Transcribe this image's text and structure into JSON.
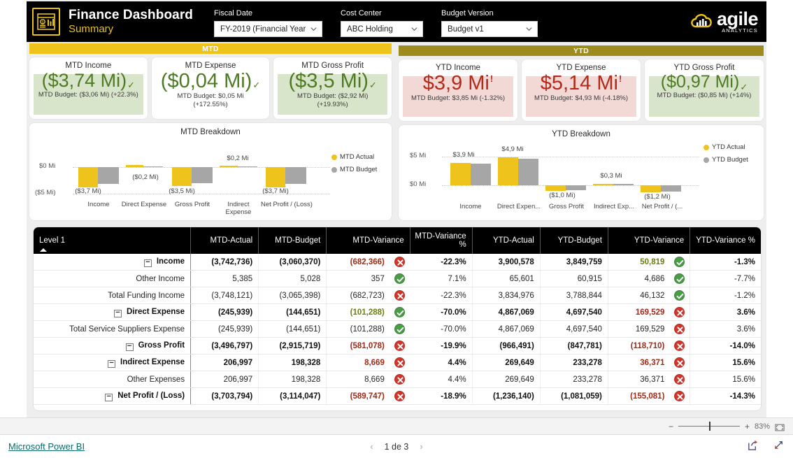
{
  "header": {
    "title": "Finance Dashboard",
    "subtitle": "Summary",
    "logo_icon": "finance-report-icon",
    "brand_name": "agile",
    "brand_tagline": "ANALYTICS",
    "slicers": [
      {
        "label": "Fiscal Date",
        "value": "FY-2019 (Financial Year) ..."
      },
      {
        "label": "Cost Center",
        "value": "ABC Holding"
      },
      {
        "label": "Budget Version",
        "value": "Budget v1"
      }
    ]
  },
  "colors": {
    "mtd_band": "#edc31c",
    "ytd_band": "#9d8b1d",
    "actual": "#edc31c",
    "budget": "#a6a6a6",
    "good": "#4e7a24",
    "bad": "#b5291b",
    "good_bg": "#d9e5ca",
    "bad_bg": "#f3d9d5"
  },
  "mtd_panel": {
    "band": "MTD",
    "cards": [
      {
        "title": "MTD Income",
        "value": "($3,74 Mi)",
        "mark": "✓",
        "state": "good",
        "sub_line1": "MTD Budget: ($3,06 Mi) (+22.3%)",
        "sub_line2": ""
      },
      {
        "title": "MTD Expense",
        "value": "($0,04 Mi)",
        "mark": "✓",
        "state": "good",
        "sub_line1": "MTD Budget: $0,05 Mi",
        "sub_line2": "(+172.55%)"
      },
      {
        "title": "MTD Gross Profit",
        "value": "($3,5 Mi)",
        "mark": "✓",
        "state": "good",
        "sub_line1": "MTD Budget: ($2,92 Mi)",
        "sub_line2": "(+19.93%)"
      }
    ]
  },
  "ytd_panel": {
    "band": "YTD",
    "cards": [
      {
        "title": "YTD Income",
        "value": "$3,9 Mi",
        "mark": "!",
        "state": "bad",
        "sub_line1": "MTD Budget: $3,85 Mi (-1.32%)",
        "sub_line2": ""
      },
      {
        "title": "YTD Expense",
        "value": "$5,14 Mi",
        "mark": "!",
        "state": "bad",
        "sub_line1": "MTD Budget: $4,93 Mi (-4.18%)",
        "sub_line2": ""
      },
      {
        "title": "YTD Gross Profit",
        "value": "($0,97 Mi)",
        "mark": "✓",
        "state": "good",
        "sub_line1": "MTD Budget: ($0,85 Mi) (+14%)",
        "sub_line2": ""
      }
    ]
  },
  "chart_data": [
    {
      "type": "bar",
      "title": "MTD Breakdown",
      "categories": [
        "Income",
        "Direct Expense",
        "Gross Profit",
        "Indirect Expense",
        "Net Profit / (Loss)"
      ],
      "series": [
        {
          "name": "MTD Actual",
          "values": [
            -3.74,
            -0.25,
            -3.5,
            0.21,
            -3.7
          ]
        },
        {
          "name": "MTD Budget",
          "values": [
            -3.06,
            -0.14,
            -2.92,
            0.2,
            -3.11
          ]
        }
      ],
      "data_labels": [
        "($3,7 Mi)",
        "($0,2 Mi)",
        "($3,5 Mi)",
        "$0,2 Mi",
        "($3,7 Mi)"
      ],
      "ytick_labels": [
        "$0 Mi",
        "($5 Mi)"
      ],
      "ylim": [
        -5,
        0.6
      ],
      "grid": true,
      "legend": [
        "MTD Actual",
        "MTD Budget"
      ],
      "legend_position": "right",
      "xlabel": "",
      "ylabel": ""
    },
    {
      "type": "bar",
      "title": "YTD Breakdown",
      "categories": [
        "Income",
        "Direct Expen...",
        "Gross Profit",
        "Indirect Exp...",
        "Net Profit / (..."
      ],
      "series": [
        {
          "name": "YTD Actual",
          "values": [
            3.9,
            4.87,
            -0.97,
            0.27,
            -1.24
          ]
        },
        {
          "name": "YTD Budget",
          "values": [
            3.85,
            4.7,
            -0.85,
            0.23,
            -1.08
          ]
        }
      ],
      "data_labels": [
        "$3,9 Mi",
        "$4,9 Mi",
        "($1,0 Mi)",
        "$0,3 Mi",
        "($1,2 Mi)"
      ],
      "ytick_labels": [
        "$5 Mi",
        "$0 Mi"
      ],
      "ylim": [
        -1.6,
        5.4
      ],
      "grid": true,
      "legend": [
        "YTD Actual",
        "YTD Budget"
      ],
      "legend_position": "right",
      "xlabel": "",
      "ylabel": ""
    }
  ],
  "matrix": {
    "columns": [
      "Level 1",
      "MTD-Actual",
      "MTD-Budget",
      "MTD-Variance",
      "MTD-Variance %",
      "YTD-Actual",
      "YTD-Budget",
      "YTD-Variance",
      "YTD-Variance %"
    ],
    "rows": [
      {
        "label": "Income",
        "level": 0,
        "expander": "−",
        "bold": true,
        "mtd_actual": "(3,742,736)",
        "mtd_budget": "(3,060,370)",
        "mtd_variance": "(682,366)",
        "mtd_var_sign": "neg",
        "mtd_icon": "bad",
        "mtd_pct": "-22.3%",
        "ytd_actual": "3,900,578",
        "ytd_budget": "3,849,759",
        "ytd_variance": "50,819",
        "ytd_var_sign": "pos",
        "ytd_icon": "ok",
        "ytd_pct": "-1.3%"
      },
      {
        "label": "Other Income",
        "level": 1,
        "expander": "",
        "bold": false,
        "mtd_actual": "5,385",
        "mtd_budget": "5,028",
        "mtd_variance": "357",
        "mtd_var_sign": "pos",
        "mtd_icon": "ok",
        "mtd_pct": "7.1%",
        "ytd_actual": "65,601",
        "ytd_budget": "60,915",
        "ytd_variance": "4,686",
        "ytd_var_sign": "pos",
        "ytd_icon": "ok",
        "ytd_pct": "-7.7%"
      },
      {
        "label": "Total Funding Income",
        "level": 1,
        "expander": "",
        "bold": false,
        "mtd_actual": "(3,748,121)",
        "mtd_budget": "(3,065,398)",
        "mtd_variance": "(682,723)",
        "mtd_var_sign": "neg",
        "mtd_icon": "bad",
        "mtd_pct": "-22.3%",
        "ytd_actual": "3,834,976",
        "ytd_budget": "3,788,844",
        "ytd_variance": "46,132",
        "ytd_var_sign": "pos",
        "ytd_icon": "ok",
        "ytd_pct": "-1.2%"
      },
      {
        "label": "Direct Expense",
        "level": 0,
        "expander": "−",
        "bold": true,
        "mtd_actual": "(245,939)",
        "mtd_budget": "(144,651)",
        "mtd_variance": "(101,288)",
        "mtd_var_sign": "pos",
        "mtd_icon": "ok",
        "mtd_pct": "-70.0%",
        "ytd_actual": "4,867,069",
        "ytd_budget": "4,697,540",
        "ytd_variance": "169,529",
        "ytd_var_sign": "neg",
        "ytd_icon": "bad",
        "ytd_pct": "3.6%"
      },
      {
        "label": "Total Service Suppliers Expense",
        "level": 1,
        "expander": "",
        "bold": false,
        "mtd_actual": "(245,939)",
        "mtd_budget": "(144,651)",
        "mtd_variance": "(101,288)",
        "mtd_var_sign": "pos",
        "mtd_icon": "ok",
        "mtd_pct": "-70.0%",
        "ytd_actual": "4,867,069",
        "ytd_budget": "4,697,540",
        "ytd_variance": "169,529",
        "ytd_var_sign": "neg",
        "ytd_icon": "bad",
        "ytd_pct": "3.6%"
      },
      {
        "label": "Gross Profit",
        "level": 0,
        "expander": "−",
        "bold": true,
        "mtd_actual": "(3,496,797)",
        "mtd_budget": "(2,915,719)",
        "mtd_variance": "(581,078)",
        "mtd_var_sign": "neg",
        "mtd_icon": "bad",
        "mtd_pct": "-19.9%",
        "ytd_actual": "(966,491)",
        "ytd_budget": "(847,781)",
        "ytd_variance": "(118,710)",
        "ytd_var_sign": "neg",
        "ytd_icon": "bad",
        "ytd_pct": "-14.0%"
      },
      {
        "label": "Indirect Expense",
        "level": 0,
        "expander": "−",
        "bold": true,
        "mtd_actual": "206,997",
        "mtd_budget": "198,328",
        "mtd_variance": "8,669",
        "mtd_var_sign": "neg",
        "mtd_icon": "bad",
        "mtd_pct": "4.4%",
        "ytd_actual": "269,649",
        "ytd_budget": "233,278",
        "ytd_variance": "36,371",
        "ytd_var_sign": "neg",
        "ytd_icon": "bad",
        "ytd_pct": "15.6%"
      },
      {
        "label": "Other Expenses",
        "level": 1,
        "expander": "",
        "bold": false,
        "mtd_actual": "206,997",
        "mtd_budget": "198,328",
        "mtd_variance": "8,669",
        "mtd_var_sign": "neg",
        "mtd_icon": "bad",
        "mtd_pct": "4.4%",
        "ytd_actual": "269,649",
        "ytd_budget": "233,278",
        "ytd_variance": "36,371",
        "ytd_var_sign": "neg",
        "ytd_icon": "bad",
        "ytd_pct": "15.6%"
      },
      {
        "label": "Net Profit / (Loss)",
        "level": 0,
        "expander": "−",
        "bold": true,
        "mtd_actual": "(3,703,794)",
        "mtd_budget": "(3,114,047)",
        "mtd_variance": "(589,747)",
        "mtd_var_sign": "neg",
        "mtd_icon": "bad",
        "mtd_pct": "-18.9%",
        "ytd_actual": "(1,236,140)",
        "ytd_budget": "(1,081,059)",
        "ytd_variance": "(155,081)",
        "ytd_var_sign": "neg",
        "ytd_icon": "bad",
        "ytd_pct": "-14.3%"
      }
    ]
  },
  "zoombar": {
    "minus": "−",
    "plus": "+",
    "percent": "83%",
    "fit_icon": "fit-to-page-icon"
  },
  "footer": {
    "brand_link": "Microsoft Power BI",
    "prev_icon": "‹",
    "page_indicator": "1 de 3",
    "next_icon": "›",
    "share_icon": "share-icon",
    "fullscreen_icon": "fullscreen-icon"
  }
}
